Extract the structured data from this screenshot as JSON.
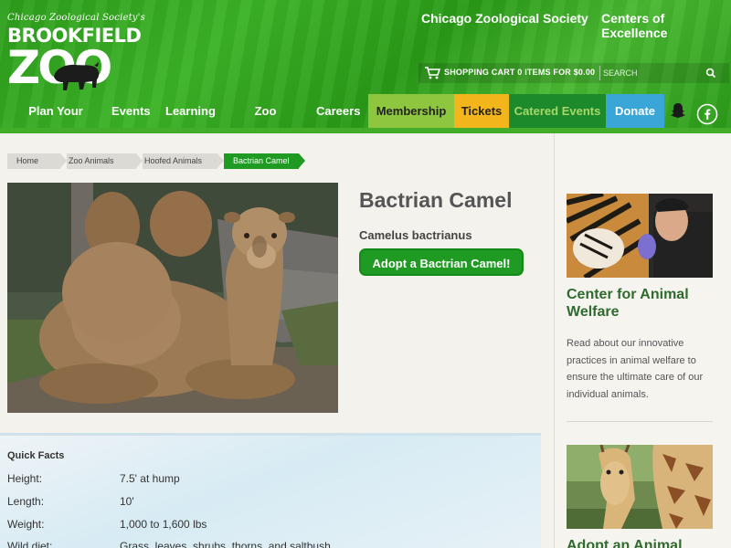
{
  "header": {
    "logo_society": "Chicago Zoological Society's",
    "logo_brand": "BROOKFIELD",
    "logo_zoo": "ZOO",
    "links": [
      "Chicago Zoological Society",
      "Centers of Excellence"
    ],
    "cart_text": "SHOPPING CART  0 ITEMS FOR $0.00",
    "search_placeholder": "SEARCH"
  },
  "nav": {
    "items": [
      "Plan Your Visit",
      "Events",
      "Learning",
      "Zoo Animals",
      "Careers"
    ],
    "pills": [
      {
        "label": "Membership",
        "color": "#8fc63f",
        "text": "#222"
      },
      {
        "label": "Tickets",
        "color": "#f3b51c",
        "text": "#222"
      },
      {
        "label": "Catered Events",
        "color": "#1c8a2a",
        "text": "#a9d66a"
      },
      {
        "label": "Donate",
        "color": "#3aa6d8",
        "text": "#fff"
      }
    ]
  },
  "breadcrumb": [
    "Home",
    "Zoo Animals",
    "Hoofed Animals",
    "Bactrian Camel"
  ],
  "animal": {
    "title": "Bactrian Camel",
    "scientific_name": "Camelus bactrianus",
    "adopt_label": "Adopt a Bactrian Camel!"
  },
  "quick_facts": {
    "title": "Quick Facts",
    "rows": [
      {
        "label": "Height:",
        "value": "7.5' at hump"
      },
      {
        "label": "Length:",
        "value": "10'"
      },
      {
        "label": "Weight:",
        "value": "1,000 to 1,600 lbs"
      },
      {
        "label": "Wild diet:",
        "value": "Grass, leaves, shrubs, thorns, and saltbush"
      }
    ]
  },
  "sidebar": {
    "welfare_heading": "Center for Animal Welfare",
    "welfare_text": "Read about our innovative practices in animal welfare to ensure the ultimate care of our individual animals.",
    "adopt_heading": "Adopt an Animal"
  },
  "colors": {
    "brand_green": "#1f9a22",
    "header_green": "#36a820"
  }
}
